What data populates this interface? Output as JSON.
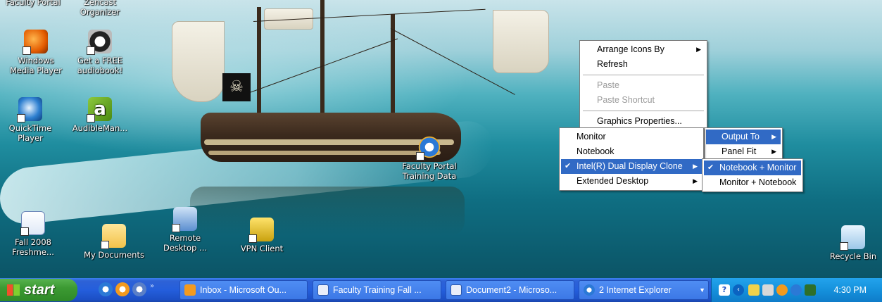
{
  "desktop": {
    "icons": [
      {
        "key": "faculty_portal_top",
        "label": "Faculty Portal",
        "icon": "faculty-portal-icon"
      },
      {
        "key": "zencast",
        "label": "Zencast Organizer",
        "icon": "zencast-organizer-icon"
      },
      {
        "key": "wmp",
        "label": "Windows Media Player",
        "icon": "windows-media-player-icon"
      },
      {
        "key": "audiobook",
        "label": "Get a FREE audiobook!",
        "icon": "audiobook-icon"
      },
      {
        "key": "quicktime",
        "label": "QuickTime Player",
        "icon": "quicktime-icon"
      },
      {
        "key": "audibleman",
        "label": "AudibleMan...",
        "icon": "audible-manager-icon"
      },
      {
        "key": "faculty_training",
        "label": "Faculty Portal Training Data",
        "icon": "internet-explorer-icon"
      },
      {
        "key": "fall2008",
        "label": "Fall 2008 Freshme...",
        "icon": "word-document-icon"
      },
      {
        "key": "mydocs",
        "label": "My Documents",
        "icon": "my-documents-icon"
      },
      {
        "key": "remote",
        "label": "Remote Desktop ...",
        "icon": "remote-desktop-icon"
      },
      {
        "key": "vpn",
        "label": "VPN Client",
        "icon": "vpn-client-icon"
      },
      {
        "key": "recycle",
        "label": "Recycle Bin",
        "icon": "recycle-bin-icon"
      }
    ]
  },
  "context_menu": {
    "items": [
      {
        "label": "Arrange Icons By",
        "submenu": true
      },
      {
        "label": "Refresh"
      },
      {
        "label": "Paste",
        "disabled": true
      },
      {
        "label": "Paste Shortcut",
        "disabled": true
      },
      {
        "label": "Graphics Properties..."
      }
    ]
  },
  "graphics_submenu": {
    "items": [
      {
        "label": "Output To",
        "submenu": true,
        "highlighted": true
      },
      {
        "label": "Panel Fit",
        "submenu": true
      }
    ]
  },
  "output_submenu": {
    "items": [
      {
        "label": "Monitor"
      },
      {
        "label": "Notebook"
      },
      {
        "label": "Intel(R) Dual Display Clone",
        "submenu": true,
        "checked": true
      },
      {
        "label": "Extended Desktop",
        "submenu": true
      }
    ]
  },
  "clone_submenu": {
    "items": [
      {
        "label": "Notebook + Monitor",
        "checked": true,
        "highlighted": true
      },
      {
        "label": "Monitor + Notebook"
      }
    ]
  },
  "taskbar": {
    "start_label": "start",
    "buttons": [
      {
        "label": "Inbox - Microsoft Ou...",
        "icon": "outlook-icon"
      },
      {
        "label": "Faculty Training Fall ...",
        "icon": "word-icon"
      },
      {
        "label": "Document2 - Microso...",
        "icon": "word-icon"
      },
      {
        "label": "2 Internet Explorer",
        "icon": "internet-explorer-icon"
      }
    ],
    "clock": "4:30 PM"
  },
  "colors": {
    "taskbar": "#245edc",
    "start": "#3c9a33",
    "menu_highlight": "#316ac5",
    "tray": "#1591dc"
  }
}
